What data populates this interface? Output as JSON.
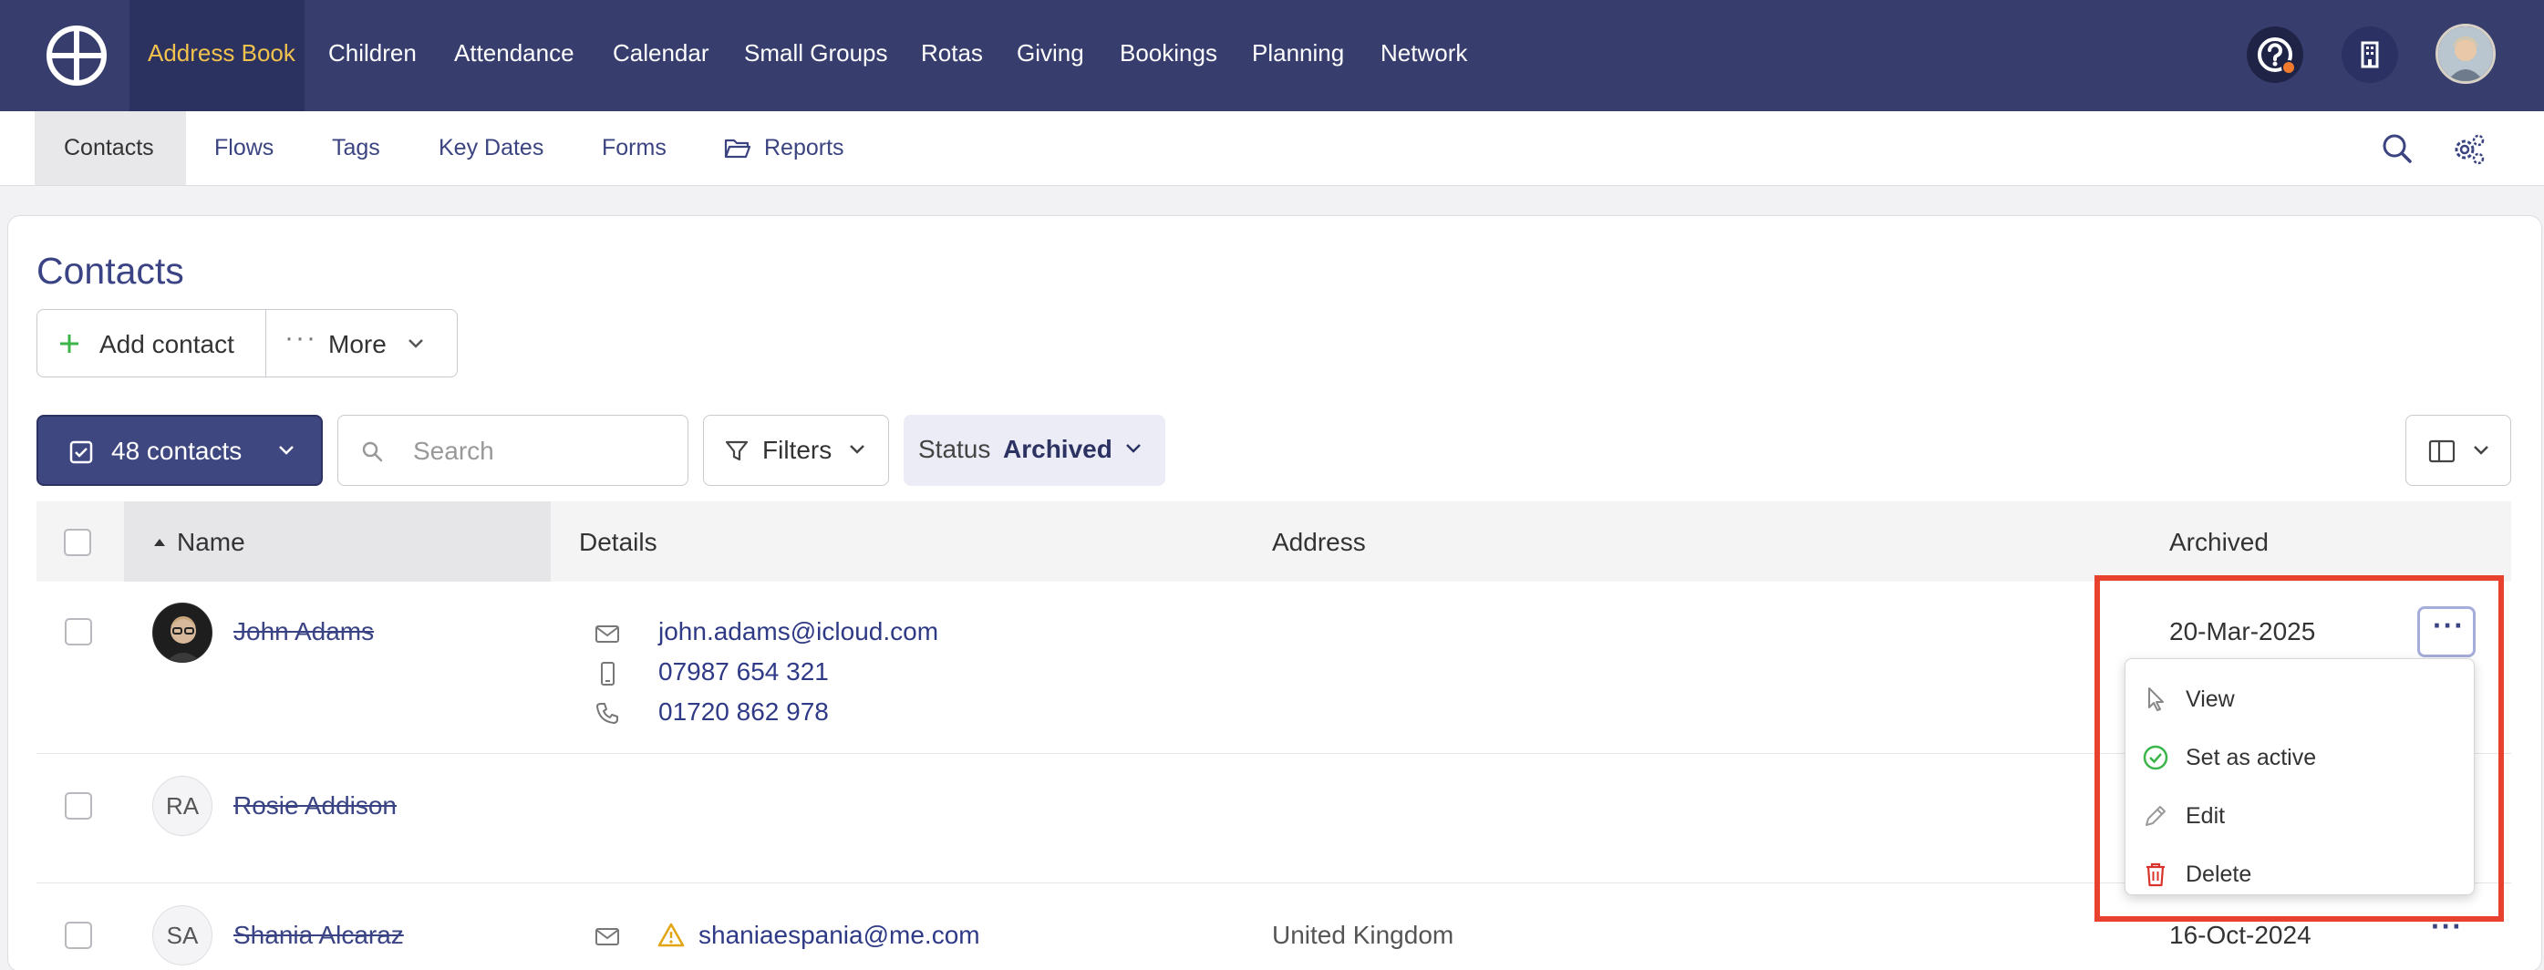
{
  "topnav": {
    "items": [
      "Address Book",
      "Children",
      "Attendance",
      "Calendar",
      "Small Groups",
      "Rotas",
      "Giving",
      "Bookings",
      "Planning",
      "Network"
    ],
    "active": "Address Book",
    "icons": [
      "help-icon",
      "building-icon",
      "user-avatar"
    ]
  },
  "subnav": {
    "items": [
      "Contacts",
      "Flows",
      "Tags",
      "Key Dates",
      "Forms",
      "Reports"
    ],
    "active": "Contacts",
    "icons": [
      "search-icon",
      "settings-icon"
    ]
  },
  "page": {
    "title": "Contacts",
    "add_contact": "Add contact",
    "more": "More"
  },
  "toolbar": {
    "contacts_count": "48 contacts",
    "search_placeholder": "Search",
    "filters": "Filters",
    "status_label": "Status",
    "status_value": "Archived"
  },
  "table": {
    "columns": [
      "Name",
      "Details",
      "Address",
      "Archived"
    ],
    "rows": [
      {
        "name": "John Adams",
        "email": "john.adams@icloud.com",
        "mobile": "07987 654 321",
        "phone": "01720 862 978",
        "address": "",
        "archived": "20-Mar-2025"
      },
      {
        "initials": "RA",
        "name": "Rosie Addison",
        "address": "",
        "archived": ""
      },
      {
        "initials": "SA",
        "name": "Shania Alcaraz",
        "email": "shaniaespania@me.com",
        "address": "United Kingdom",
        "archived": "16-Oct-2024"
      }
    ]
  },
  "row_menu": {
    "items": [
      "View",
      "Set as active",
      "Edit",
      "Delete"
    ]
  },
  "colors": {
    "nav_bg": "#373e6e",
    "active_nav_text": "#f1c24e",
    "link": "#2f3a86",
    "highlight": "#e8412e",
    "success": "#3bb54a",
    "danger": "#d9342b"
  }
}
